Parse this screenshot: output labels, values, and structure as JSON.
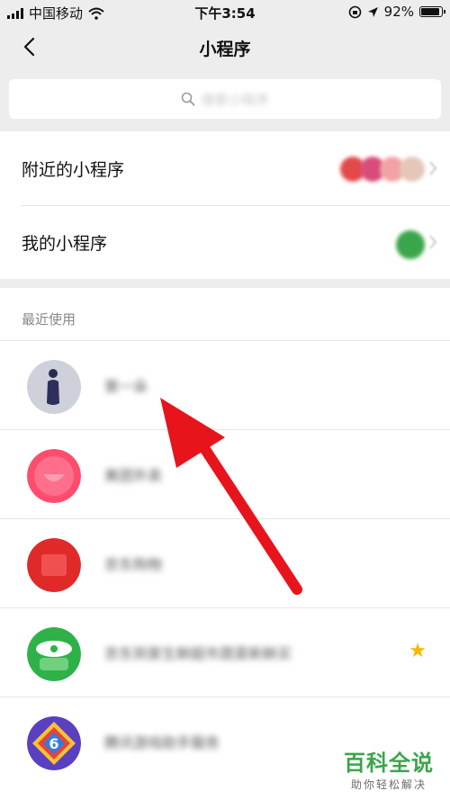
{
  "status_bar": {
    "carrier": "中国移动",
    "time": "下午3:54",
    "battery": "92%",
    "battery_level": 0.92
  },
  "nav": {
    "title": "小程序"
  },
  "search": {
    "placeholder": "搜索小程序"
  },
  "menu": {
    "nearby_label": "附近的小程序",
    "mine_label": "我的小程序"
  },
  "recent": {
    "header": "最近使用",
    "items": [
      {
        "name": "第一朵",
        "starred": false
      },
      {
        "name": "美团外卖",
        "starred": false
      },
      {
        "name": "京东购物",
        "starred": false
      },
      {
        "name": "京东到家生鲜超市蔬菜新鲜买",
        "starred": true
      },
      {
        "name": "腾讯游戏助手服务",
        "starred": false
      }
    ]
  },
  "watermark": {
    "brand": "百科全说",
    "tagline": "助你轻松解决"
  },
  "colors": {
    "watermark_green": "#3aa54b",
    "arrow_red": "#e8141c",
    "star_yellow": "#f5b800"
  }
}
